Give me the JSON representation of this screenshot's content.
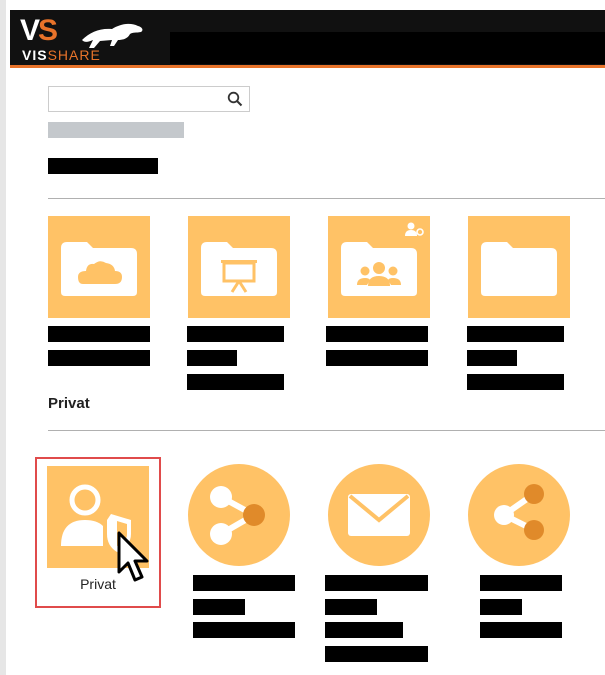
{
  "header": {
    "logo_mark": "VS",
    "logo_word_left": "VIS",
    "logo_word_right": "SHARE"
  },
  "search": {
    "value": "",
    "placeholder": ""
  },
  "sections": [
    {
      "title": "Privat"
    }
  ],
  "private_tiles": [
    {
      "label": "Privat",
      "icon": "user-shield-icon",
      "selected": true
    },
    {
      "label": "",
      "icon": "share-icon"
    },
    {
      "label": "",
      "icon": "mail-icon"
    },
    {
      "label": "",
      "icon": "share-icon"
    }
  ],
  "folder_tiles": [
    {
      "icon": "cloud-folder-icon"
    },
    {
      "icon": "presentation-folder-icon"
    },
    {
      "icon": "group-folder-icon",
      "badge": "shared-users-icon"
    },
    {
      "icon": "folder-icon"
    }
  ],
  "colors": {
    "tile": "#ffc266",
    "accent": "#e8732a",
    "selected_border": "#e04b4b",
    "header_bg": "#111111"
  }
}
